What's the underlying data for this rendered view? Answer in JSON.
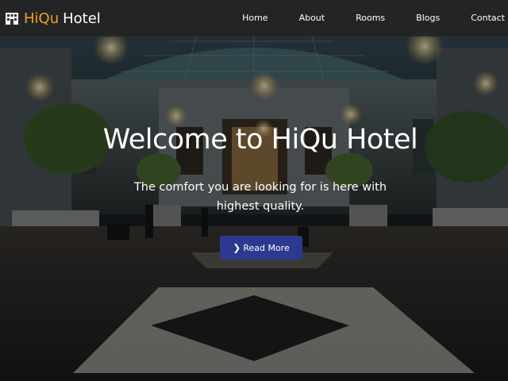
{
  "brand": {
    "icon": "hotel-building-icon",
    "name_accent": "HiQu",
    "name_rest": "Hotel",
    "accent_color": "#f0a21b"
  },
  "nav": {
    "items": [
      {
        "label": "Home"
      },
      {
        "label": "About"
      },
      {
        "label": "Rooms"
      },
      {
        "label": "Blogs"
      },
      {
        "label": "Contact"
      }
    ]
  },
  "hero": {
    "title": "Welcome to HiQu Hotel",
    "subtitle": "The comfort you are looking for is here with highest quality.",
    "button": {
      "icon": "chevron-right-icon",
      "label": "Read More",
      "color": "#2b3a8f"
    },
    "background_image": "hotel atrium lobby"
  }
}
